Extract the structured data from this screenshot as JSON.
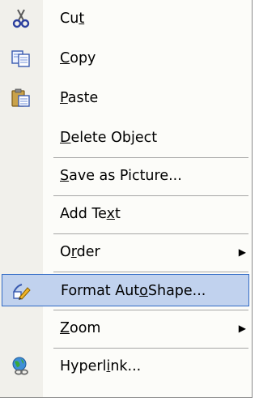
{
  "menu": {
    "items": [
      {
        "id": "cut",
        "label": "Cut",
        "icon": "scissors-icon"
      },
      {
        "id": "copy",
        "label": "Copy",
        "icon": "copy-icon"
      },
      {
        "id": "paste",
        "label": "Paste",
        "icon": "paste-icon"
      },
      {
        "id": "delete-object",
        "label": "Delete Object",
        "icon": ""
      },
      {
        "id": "save-as-picture",
        "label": "Save as Picture...",
        "icon": ""
      },
      {
        "id": "add-text",
        "label": "Add Text",
        "icon": ""
      },
      {
        "id": "order",
        "label": "Order",
        "icon": "",
        "submenu": true
      },
      {
        "id": "format-autoshape",
        "label": "Format AutoShape...",
        "icon": "format-autoshape-icon",
        "highlighted": true
      },
      {
        "id": "zoom",
        "label": "Zoom",
        "icon": "",
        "submenu": true
      },
      {
        "id": "hyperlink",
        "label": "Hyperlink...",
        "icon": "hyperlink-globe-icon"
      }
    ],
    "colors": {
      "highlight_fill": "#c1d2ee",
      "highlight_border": "#316ac5",
      "gutter": "#f1f0eb"
    }
  }
}
